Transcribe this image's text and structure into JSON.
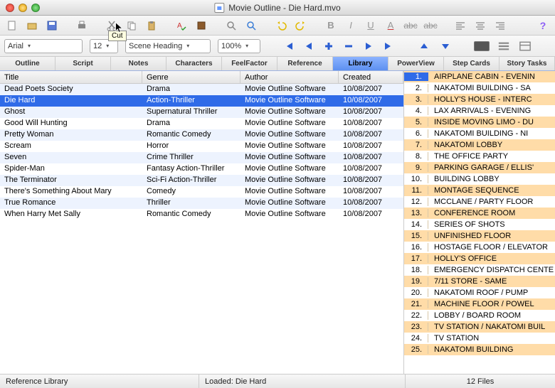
{
  "window": {
    "title": "Movie Outline - Die Hard.mvo"
  },
  "tooltip": {
    "cut": "Cut"
  },
  "format": {
    "font": "Arial",
    "size": "12",
    "style": "Scene Heading",
    "zoom": "100%"
  },
  "tabs": [
    "Outline",
    "Script",
    "Notes",
    "Characters",
    "FeelFactor",
    "Reference",
    "Library",
    "PowerView",
    "Step Cards",
    "Story Tasks"
  ],
  "active_tab": "Library",
  "columns": {
    "title": "Title",
    "genre": "Genre",
    "author": "Author",
    "created": "Created"
  },
  "library": [
    {
      "title": "Dead Poets Society",
      "genre": "Drama",
      "author": "Movie Outline Software",
      "created": "10/08/2007"
    },
    {
      "title": "Die Hard",
      "genre": "Action-Thriller",
      "author": "Movie Outline Software",
      "created": "10/08/2007"
    },
    {
      "title": "Ghost",
      "genre": "Supernatural Thriller",
      "author": "Movie Outline Software",
      "created": "10/08/2007"
    },
    {
      "title": "Good Will Hunting",
      "genre": "Drama",
      "author": "Movie Outline Software",
      "created": "10/08/2007"
    },
    {
      "title": "Pretty Woman",
      "genre": "Romantic Comedy",
      "author": "Movie Outline Software",
      "created": "10/08/2007"
    },
    {
      "title": "Scream",
      "genre": "Horror",
      "author": "Movie Outline Software",
      "created": "10/08/2007"
    },
    {
      "title": "Seven",
      "genre": "Crime Thriller",
      "author": "Movie Outline Software",
      "created": "10/08/2007"
    },
    {
      "title": "Spider-Man",
      "genre": "Fantasy Action-Thriller",
      "author": "Movie Outline Software",
      "created": "10/08/2007"
    },
    {
      "title": "The Terminator",
      "genre": "Sci-Fi Action-Thriller",
      "author": "Movie Outline Software",
      "created": "10/08/2007"
    },
    {
      "title": "There's Something About Mary",
      "genre": "Comedy",
      "author": "Movie Outline Software",
      "created": "10/08/2007"
    },
    {
      "title": "True Romance",
      "genre": "Thriller",
      "author": "Movie Outline Software",
      "created": "10/08/2007"
    },
    {
      "title": "When Harry Met Sally",
      "genre": "Romantic Comedy",
      "author": "Movie Outline Software",
      "created": "10/08/2007"
    }
  ],
  "selected_library_index": 1,
  "scenes": [
    "AIRPLANE CABIN - EVENIN",
    "NAKATOMI BUILDING - SA",
    "HOLLY'S HOUSE - INTERC",
    "LAX ARRIVALS - EVENING",
    "INSIDE MOVING LIMO - DU",
    "NAKATOMI BUILDING - NI",
    "NAKATOMI LOBBY",
    "THE OFFICE PARTY",
    "PARKING GARAGE / ELLIS'",
    "BUILDING LOBBY",
    "MONTAGE SEQUENCE",
    "MCCLANE / PARTY FLOOR",
    "CONFERENCE ROOM",
    "SERIES OF SHOTS",
    "UNFINISHED FLOOR",
    "HOSTAGE FLOOR / ELEVATOR",
    "HOLLY'S OFFICE",
    "EMERGENCY DISPATCH CENTE",
    "7/11 STORE - SAME",
    "NAKATOMI ROOF / PUMP",
    "MACHINE FLOOR / POWEL",
    "LOBBY / BOARD ROOM",
    "TV STATION / NAKATOMI BUIL",
    "TV STATION",
    "NAKATOMI BUILDING"
  ],
  "status": {
    "left": "Reference Library",
    "mid": "Loaded: Die Hard",
    "right": "12 Files"
  }
}
